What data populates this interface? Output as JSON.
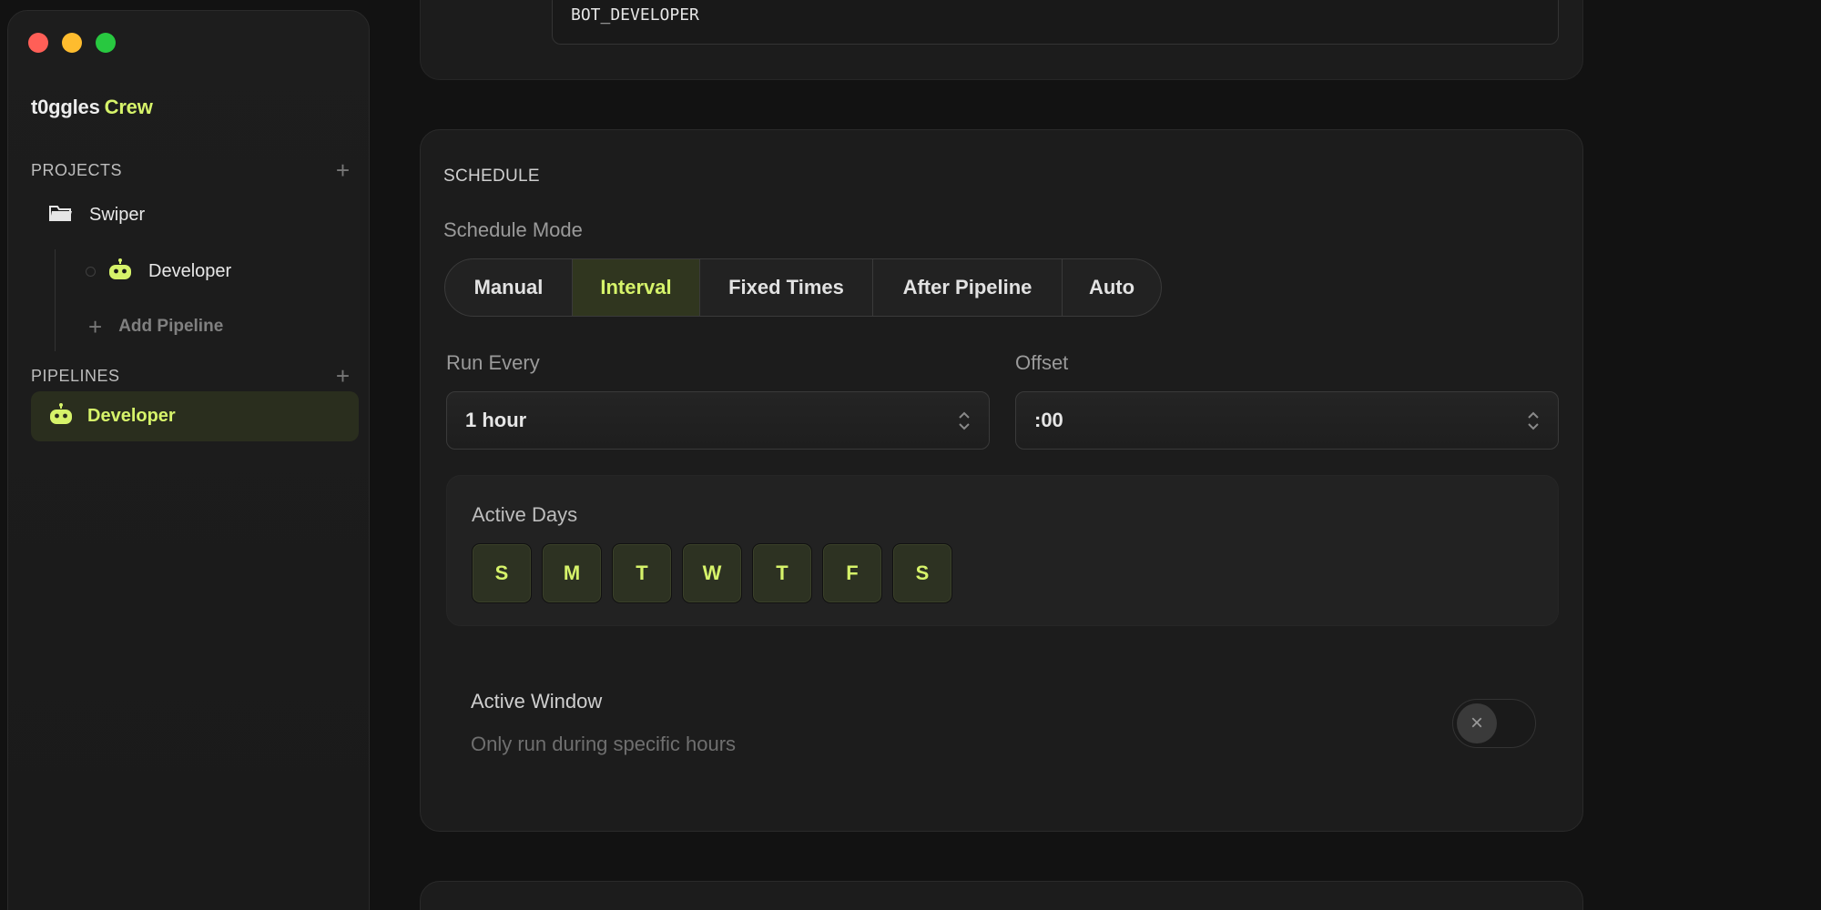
{
  "window": {
    "controls": [
      "close",
      "minimize",
      "zoom"
    ]
  },
  "brand": {
    "name": "t0ggles",
    "suffix": "Crew"
  },
  "sidebar": {
    "projects_label": "PROJECTS",
    "project": {
      "name": "Swiper",
      "icon": "folder-icon"
    },
    "project_pipeline": {
      "name": "Developer",
      "icon": "robot-icon"
    },
    "add_pipeline_label": "Add Pipeline",
    "pipelines_label": "PIPELINES",
    "active_pipeline": {
      "name": "Developer",
      "icon": "robot-icon"
    }
  },
  "top_card": {
    "code_value": "BOT_DEVELOPER"
  },
  "schedule": {
    "title": "SCHEDULE",
    "mode_label": "Schedule Mode",
    "modes": [
      "Manual",
      "Interval",
      "Fixed Times",
      "After Pipeline",
      "Auto"
    ],
    "active_mode": "Interval",
    "run_every_label": "Run Every",
    "run_every_value": "1 hour",
    "offset_label": "Offset",
    "offset_value": ":00",
    "active_days_label": "Active Days",
    "days": [
      "S",
      "M",
      "T",
      "W",
      "T",
      "F",
      "S"
    ],
    "active_window_label": "Active Window",
    "active_window_desc": "Only run during specific hours",
    "active_window_enabled": false
  },
  "colors": {
    "accent": "#d6f36a",
    "background": "#121212",
    "card": "#1c1c1c",
    "close": "#ff5f57",
    "minimize": "#febc2e",
    "zoom": "#28c840"
  }
}
